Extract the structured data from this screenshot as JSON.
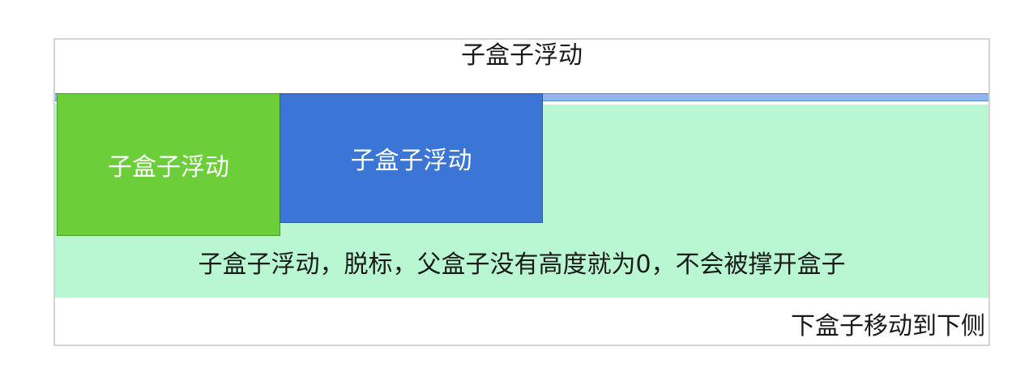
{
  "diagram": {
    "top_title": "子盒子浮动",
    "float_box_green": "子盒子浮动",
    "float_box_blue": "子盒子浮动",
    "explanation": "子盒子浮动，脱标，父盒子没有高度就为0，不会被撑开盒子",
    "bottom_label": "下盒子移动到下侧",
    "colors": {
      "green_box": "#6ccf3a",
      "blue_box": "#3b76d6",
      "mint_area": "#b9f7d2",
      "parent_line": "#8fb4ee"
    }
  }
}
